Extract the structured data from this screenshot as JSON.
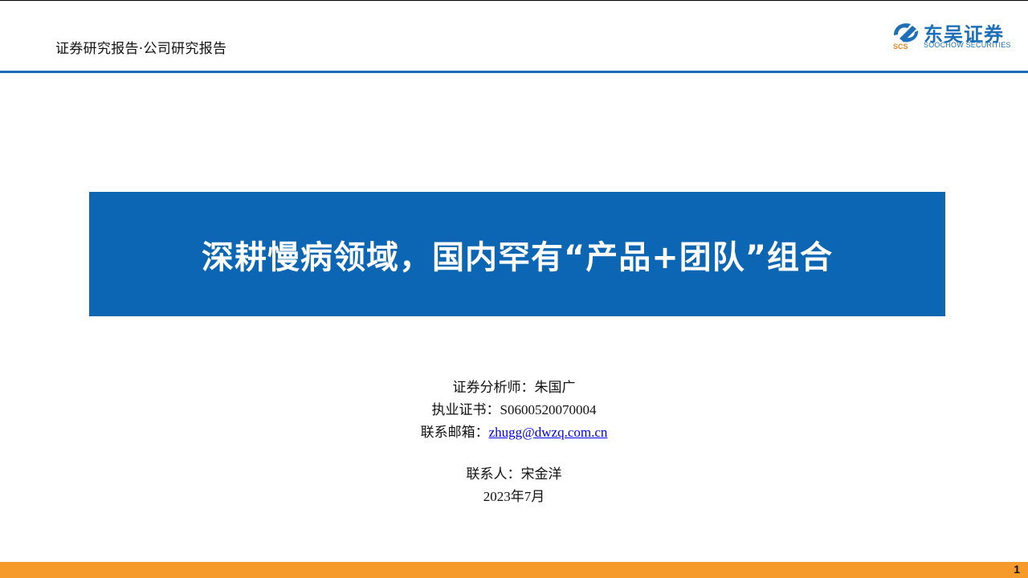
{
  "header": {
    "report_type": "证券研究报告·公司研究报告",
    "logo": {
      "cn_name": "东吴证券",
      "en_name": "SOOCHOW SECURITIES",
      "mark_text": "SCS",
      "brand_color": "#1d6fb8"
    },
    "rule_color": "#1a6cb5"
  },
  "title": {
    "text": "深耕慢病领域，国内罕有“产品+团队”组合",
    "bg_color": "#0c66b4"
  },
  "info": {
    "analyst_label": "证券分析师：",
    "analyst_name": "朱国广",
    "cert_label": "执业证书：",
    "cert_no": "S0600520070004",
    "email_label": "联系邮箱：",
    "email": "zhugg@dwzq.com.cn",
    "contact_label": "联系人：",
    "contact_name": "宋金洋",
    "date": "2023年7月"
  },
  "footer": {
    "page_number": "1",
    "bar_color": "#f79a2c"
  }
}
